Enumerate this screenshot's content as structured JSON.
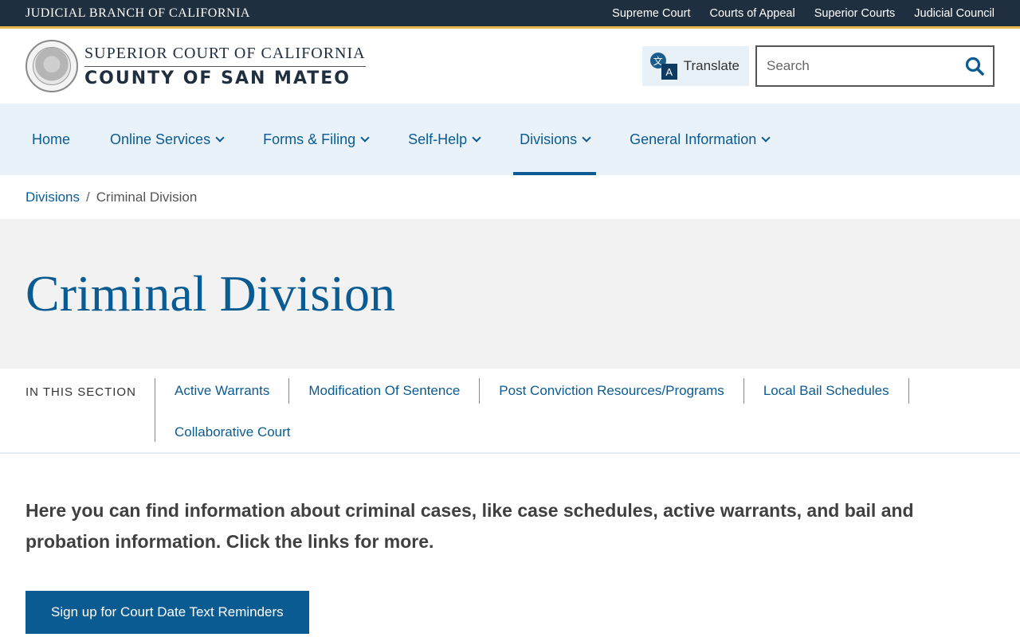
{
  "topbar": {
    "branch": "JUDICIAL BRANCH OF CALIFORNIA",
    "links": [
      "Supreme Court",
      "Courts of Appeal",
      "Superior Courts",
      "Judicial Council"
    ]
  },
  "header": {
    "title_line1": "SUPERIOR COURT OF CALIFORNIA",
    "title_line2": "COUNTY OF SAN MATEO",
    "translate_label": "Translate",
    "search_placeholder": "Search"
  },
  "nav": {
    "items": [
      "Home",
      "Online Services",
      "Forms & Filing",
      "Self-Help",
      "Divisions",
      "General Information"
    ],
    "active": "Divisions"
  },
  "breadcrumb": {
    "parent": "Divisions",
    "separator": "/",
    "current": "Criminal Division"
  },
  "page": {
    "title": "Criminal Division"
  },
  "section_nav": {
    "label": "IN THIS SECTION",
    "links": [
      "Active Warrants",
      "Modification Of Sentence",
      "Post Conviction Resources/Programs",
      "Local Bail Schedules",
      "Collaborative Court"
    ]
  },
  "content": {
    "intro": "Here you can find information about criminal cases, like case schedules, active warrants, and bail and probation information. Click the links for more.",
    "cta_label": "Sign up for Court Date Text Reminders"
  },
  "colors": {
    "topbar_bg": "#1f2f3f",
    "accent": "#0b5b93",
    "gold": "#e8b84a",
    "nav_bg": "#eaf2f9",
    "hero_bg": "#f2f2f2"
  }
}
